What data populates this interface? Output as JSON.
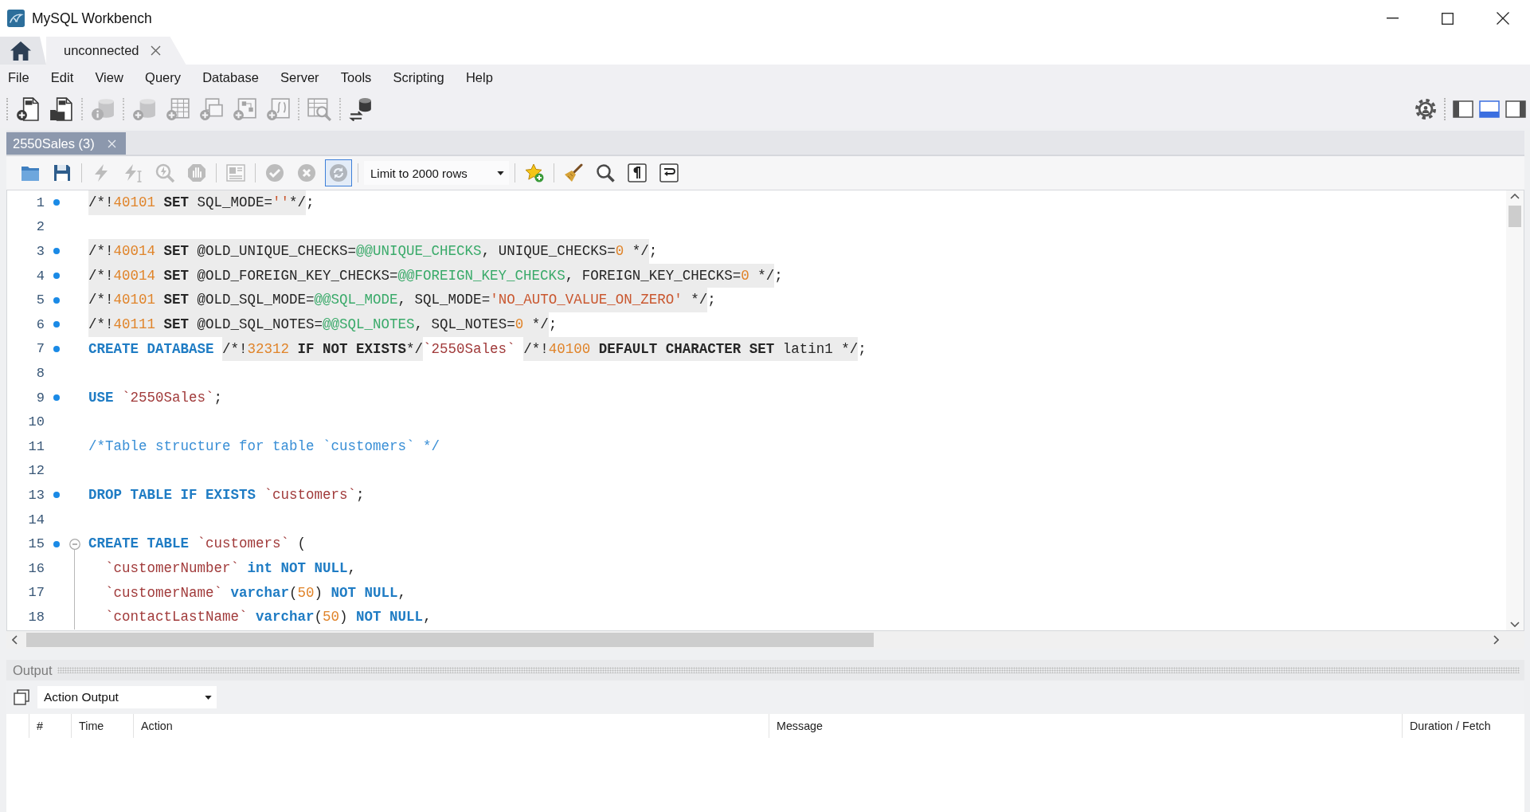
{
  "window": {
    "title": "MySQL Workbench"
  },
  "tabs": [
    {
      "kind": "home",
      "selected": false
    },
    {
      "kind": "connection",
      "label": "unconnected",
      "selected": true
    }
  ],
  "menu": [
    "File",
    "Edit",
    "View",
    "Query",
    "Database",
    "Server",
    "Tools",
    "Scripting",
    "Help"
  ],
  "toolbar": {
    "groups": [
      [
        {
          "disabled": false
        },
        {
          "disabled": false
        }
      ],
      [
        {
          "disabled": true
        }
      ],
      [
        {
          "disabled": true
        },
        {
          "disabled": true
        },
        {
          "disabled": true
        },
        {
          "disabled": true
        },
        {
          "disabled": true
        }
      ],
      [
        {
          "disabled": true
        }
      ],
      [
        {
          "disabled": false
        }
      ]
    ],
    "layout_toggles": [
      {
        "selected": false
      },
      {
        "selected": true
      },
      {
        "selected": false
      }
    ]
  },
  "query_tabs": [
    {
      "label": "2550Sales (3)",
      "selected": true
    }
  ],
  "editor_toolbar": {
    "groups": [
      {
        "kind": "buttons",
        "buttons": [
          {
            "disabled": false,
            "pressed": false
          },
          {
            "disabled": false,
            "pressed": false
          }
        ]
      },
      {
        "kind": "buttons",
        "buttons": [
          {
            "disabled": true,
            "pressed": false
          },
          {
            "disabled": true,
            "pressed": false
          },
          {
            "disabled": true,
            "pressed": false
          },
          {
            "disabled": true,
            "pressed": false
          }
        ]
      },
      {
        "kind": "buttons",
        "buttons": [
          {
            "disabled": true,
            "pressed": false
          }
        ]
      },
      {
        "kind": "buttons",
        "buttons": [
          {
            "disabled": true,
            "pressed": false
          },
          {
            "disabled": true,
            "pressed": false
          },
          {
            "disabled": true,
            "pressed": true
          }
        ]
      },
      {
        "kind": "select",
        "value": "Limit to 2000 rows"
      },
      {
        "kind": "buttons",
        "buttons": [
          {
            "disabled": false,
            "pressed": false
          }
        ]
      },
      {
        "kind": "buttons",
        "buttons": [
          {
            "disabled": false,
            "pressed": false
          },
          {
            "disabled": false,
            "pressed": false
          },
          {
            "disabled": false,
            "pressed": false
          },
          {
            "disabled": false,
            "pressed": false
          }
        ]
      }
    ]
  },
  "editor": {
    "lines": [
      {
        "number": "1",
        "statement": true,
        "segments": [
          {
            "kind": "conditional",
            "tokens": [
              {
                "text": "/*!",
                "kind": "text"
              },
              {
                "text": "40101",
                "kind": "number"
              },
              {
                "text": " SET",
                "kind": "bold"
              },
              {
                "text": " SQL_MODE=",
                "kind": "text"
              },
              {
                "text": "''",
                "kind": "string"
              },
              {
                "text": "*/",
                "kind": "text"
              }
            ]
          },
          {
            "kind": "plain",
            "tokens": [
              {
                "text": ";",
                "kind": "text"
              }
            ]
          }
        ]
      },
      {
        "number": "2",
        "statement": false
      },
      {
        "number": "3",
        "statement": true,
        "segments": [
          {
            "kind": "conditional",
            "tokens": [
              {
                "text": "/*!",
                "kind": "text"
              },
              {
                "text": "40014",
                "kind": "number"
              },
              {
                "text": " SET",
                "kind": "bold"
              },
              {
                "text": " @OLD_UNIQUE_CHECKS=",
                "kind": "text"
              },
              {
                "text": "@@UNIQUE_CHECKS",
                "kind": "variable"
              },
              {
                "text": ", UNIQUE_CHECKS=",
                "kind": "text"
              },
              {
                "text": "0",
                "kind": "number"
              },
              {
                "text": " */",
                "kind": "text"
              }
            ]
          },
          {
            "kind": "plain",
            "tokens": [
              {
                "text": ";",
                "kind": "text"
              }
            ]
          }
        ]
      },
      {
        "number": "4",
        "statement": true,
        "segments": [
          {
            "kind": "conditional",
            "tokens": [
              {
                "text": "/*!",
                "kind": "text"
              },
              {
                "text": "40014",
                "kind": "number"
              },
              {
                "text": " SET",
                "kind": "bold"
              },
              {
                "text": " @OLD_FOREIGN_KEY_CHECKS=",
                "kind": "text"
              },
              {
                "text": "@@FOREIGN_KEY_CHECKS",
                "kind": "variable"
              },
              {
                "text": ", FOREIGN_KEY_CHECKS=",
                "kind": "text"
              },
              {
                "text": "0",
                "kind": "number"
              },
              {
                "text": " */",
                "kind": "text"
              }
            ]
          },
          {
            "kind": "plain",
            "tokens": [
              {
                "text": ";",
                "kind": "text"
              }
            ]
          }
        ]
      },
      {
        "number": "5",
        "statement": true,
        "segments": [
          {
            "kind": "conditional",
            "tokens": [
              {
                "text": "/*!",
                "kind": "text"
              },
              {
                "text": "40101",
                "kind": "number"
              },
              {
                "text": " SET",
                "kind": "bold"
              },
              {
                "text": " @OLD_SQL_MODE=",
                "kind": "text"
              },
              {
                "text": "@@SQL_MODE",
                "kind": "variable"
              },
              {
                "text": ", SQL_MODE=",
                "kind": "text"
              },
              {
                "text": "'NO_AUTO_VALUE_ON_ZERO'",
                "kind": "string"
              },
              {
                "text": " */",
                "kind": "text"
              }
            ]
          },
          {
            "kind": "plain",
            "tokens": [
              {
                "text": ";",
                "kind": "text"
              }
            ]
          }
        ]
      },
      {
        "number": "6",
        "statement": true,
        "segments": [
          {
            "kind": "conditional",
            "tokens": [
              {
                "text": "/*!",
                "kind": "text"
              },
              {
                "text": "40111",
                "kind": "number"
              },
              {
                "text": " SET",
                "kind": "bold"
              },
              {
                "text": " @OLD_SQL_NOTES=",
                "kind": "text"
              },
              {
                "text": "@@SQL_NOTES",
                "kind": "variable"
              },
              {
                "text": ", SQL_NOTES=",
                "kind": "text"
              },
              {
                "text": "0",
                "kind": "number"
              },
              {
                "text": " */",
                "kind": "text"
              }
            ]
          },
          {
            "kind": "plain",
            "tokens": [
              {
                "text": ";",
                "kind": "text"
              }
            ]
          }
        ]
      },
      {
        "number": "7",
        "statement": true,
        "segments": [
          {
            "kind": "plain",
            "tokens": [
              {
                "text": "CREATE DATABASE ",
                "kind": "keyword"
              }
            ]
          },
          {
            "kind": "conditional",
            "tokens": [
              {
                "text": "/*!",
                "kind": "text"
              },
              {
                "text": "32312",
                "kind": "number"
              },
              {
                "text": " IF NOT EXISTS",
                "kind": "bold"
              },
              {
                "text": "*/",
                "kind": "text"
              }
            ]
          },
          {
            "kind": "plain",
            "tokens": [
              {
                "text": "`2550Sales` ",
                "kind": "identifier"
              }
            ]
          },
          {
            "kind": "conditional",
            "tokens": [
              {
                "text": "/*!",
                "kind": "text"
              },
              {
                "text": "40100",
                "kind": "number"
              },
              {
                "text": " DEFAULT CHARACTER SET",
                "kind": "bold"
              },
              {
                "text": " latin1 */",
                "kind": "text"
              }
            ]
          },
          {
            "kind": "plain",
            "tokens": [
              {
                "text": ";",
                "kind": "text"
              }
            ]
          }
        ]
      },
      {
        "number": "8",
        "statement": false
      },
      {
        "number": "9",
        "statement": true,
        "segments": [
          {
            "kind": "plain",
            "tokens": [
              {
                "text": "USE ",
                "kind": "keyword"
              },
              {
                "text": "`2550Sales`",
                "kind": "identifier"
              },
              {
                "text": ";",
                "kind": "text"
              }
            ]
          }
        ]
      },
      {
        "number": "10",
        "statement": false
      },
      {
        "number": "11",
        "statement": false,
        "segments": [
          {
            "kind": "plain",
            "tokens": [
              {
                "text": "/*Table structure for table `customers` */",
                "kind": "comment"
              }
            ]
          }
        ]
      },
      {
        "number": "12",
        "statement": false
      },
      {
        "number": "13",
        "statement": true,
        "segments": [
          {
            "kind": "plain",
            "tokens": [
              {
                "text": "DROP TABLE IF EXISTS ",
                "kind": "keyword"
              },
              {
                "text": "`customers`",
                "kind": "identifier"
              },
              {
                "text": ";",
                "kind": "text"
              }
            ]
          }
        ]
      },
      {
        "number": "14",
        "statement": false
      },
      {
        "number": "15",
        "statement": true,
        "expanded": true,
        "segments": [
          {
            "kind": "plain",
            "tokens": [
              {
                "text": "CREATE TABLE ",
                "kind": "keyword"
              },
              {
                "text": "`customers`",
                "kind": "identifier"
              },
              {
                "text": " (",
                "kind": "text"
              }
            ]
          }
        ],
        "children": [
          {
            "number": "16",
            "statement": false,
            "segments": [
              {
                "kind": "plain",
                "tokens": [
                  {
                    "text": "  `customerNumber`",
                    "kind": "identifier"
                  },
                  {
                    "text": " int NOT NULL",
                    "kind": "keyword"
                  },
                  {
                    "text": ",",
                    "kind": "text"
                  }
                ]
              }
            ]
          },
          {
            "number": "17",
            "statement": false,
            "segments": [
              {
                "kind": "plain",
                "tokens": [
                  {
                    "text": "  `customerName`",
                    "kind": "identifier"
                  },
                  {
                    "text": " varchar",
                    "kind": "keyword"
                  },
                  {
                    "text": "(",
                    "kind": "text"
                  },
                  {
                    "text": "50",
                    "kind": "number"
                  },
                  {
                    "text": ")",
                    "kind": "text"
                  },
                  {
                    "text": " NOT NULL",
                    "kind": "keyword"
                  },
                  {
                    "text": ",",
                    "kind": "text"
                  }
                ]
              }
            ]
          },
          {
            "number": "18",
            "statement": false,
            "segments": [
              {
                "kind": "plain",
                "tokens": [
                  {
                    "text": "  `contactLastName`",
                    "kind": "identifier"
                  },
                  {
                    "text": " varchar",
                    "kind": "keyword"
                  },
                  {
                    "text": "(",
                    "kind": "text"
                  },
                  {
                    "text": "50",
                    "kind": "number"
                  },
                  {
                    "text": ")",
                    "kind": "text"
                  },
                  {
                    "text": " NOT NULL",
                    "kind": "keyword"
                  },
                  {
                    "text": ",",
                    "kind": "text"
                  }
                ]
              }
            ]
          }
        ]
      }
    ]
  },
  "output": {
    "title": "Output",
    "source": "Action Output",
    "columns": [
      "#",
      "Time",
      "Action",
      "Message",
      "Duration / Fetch"
    ]
  }
}
